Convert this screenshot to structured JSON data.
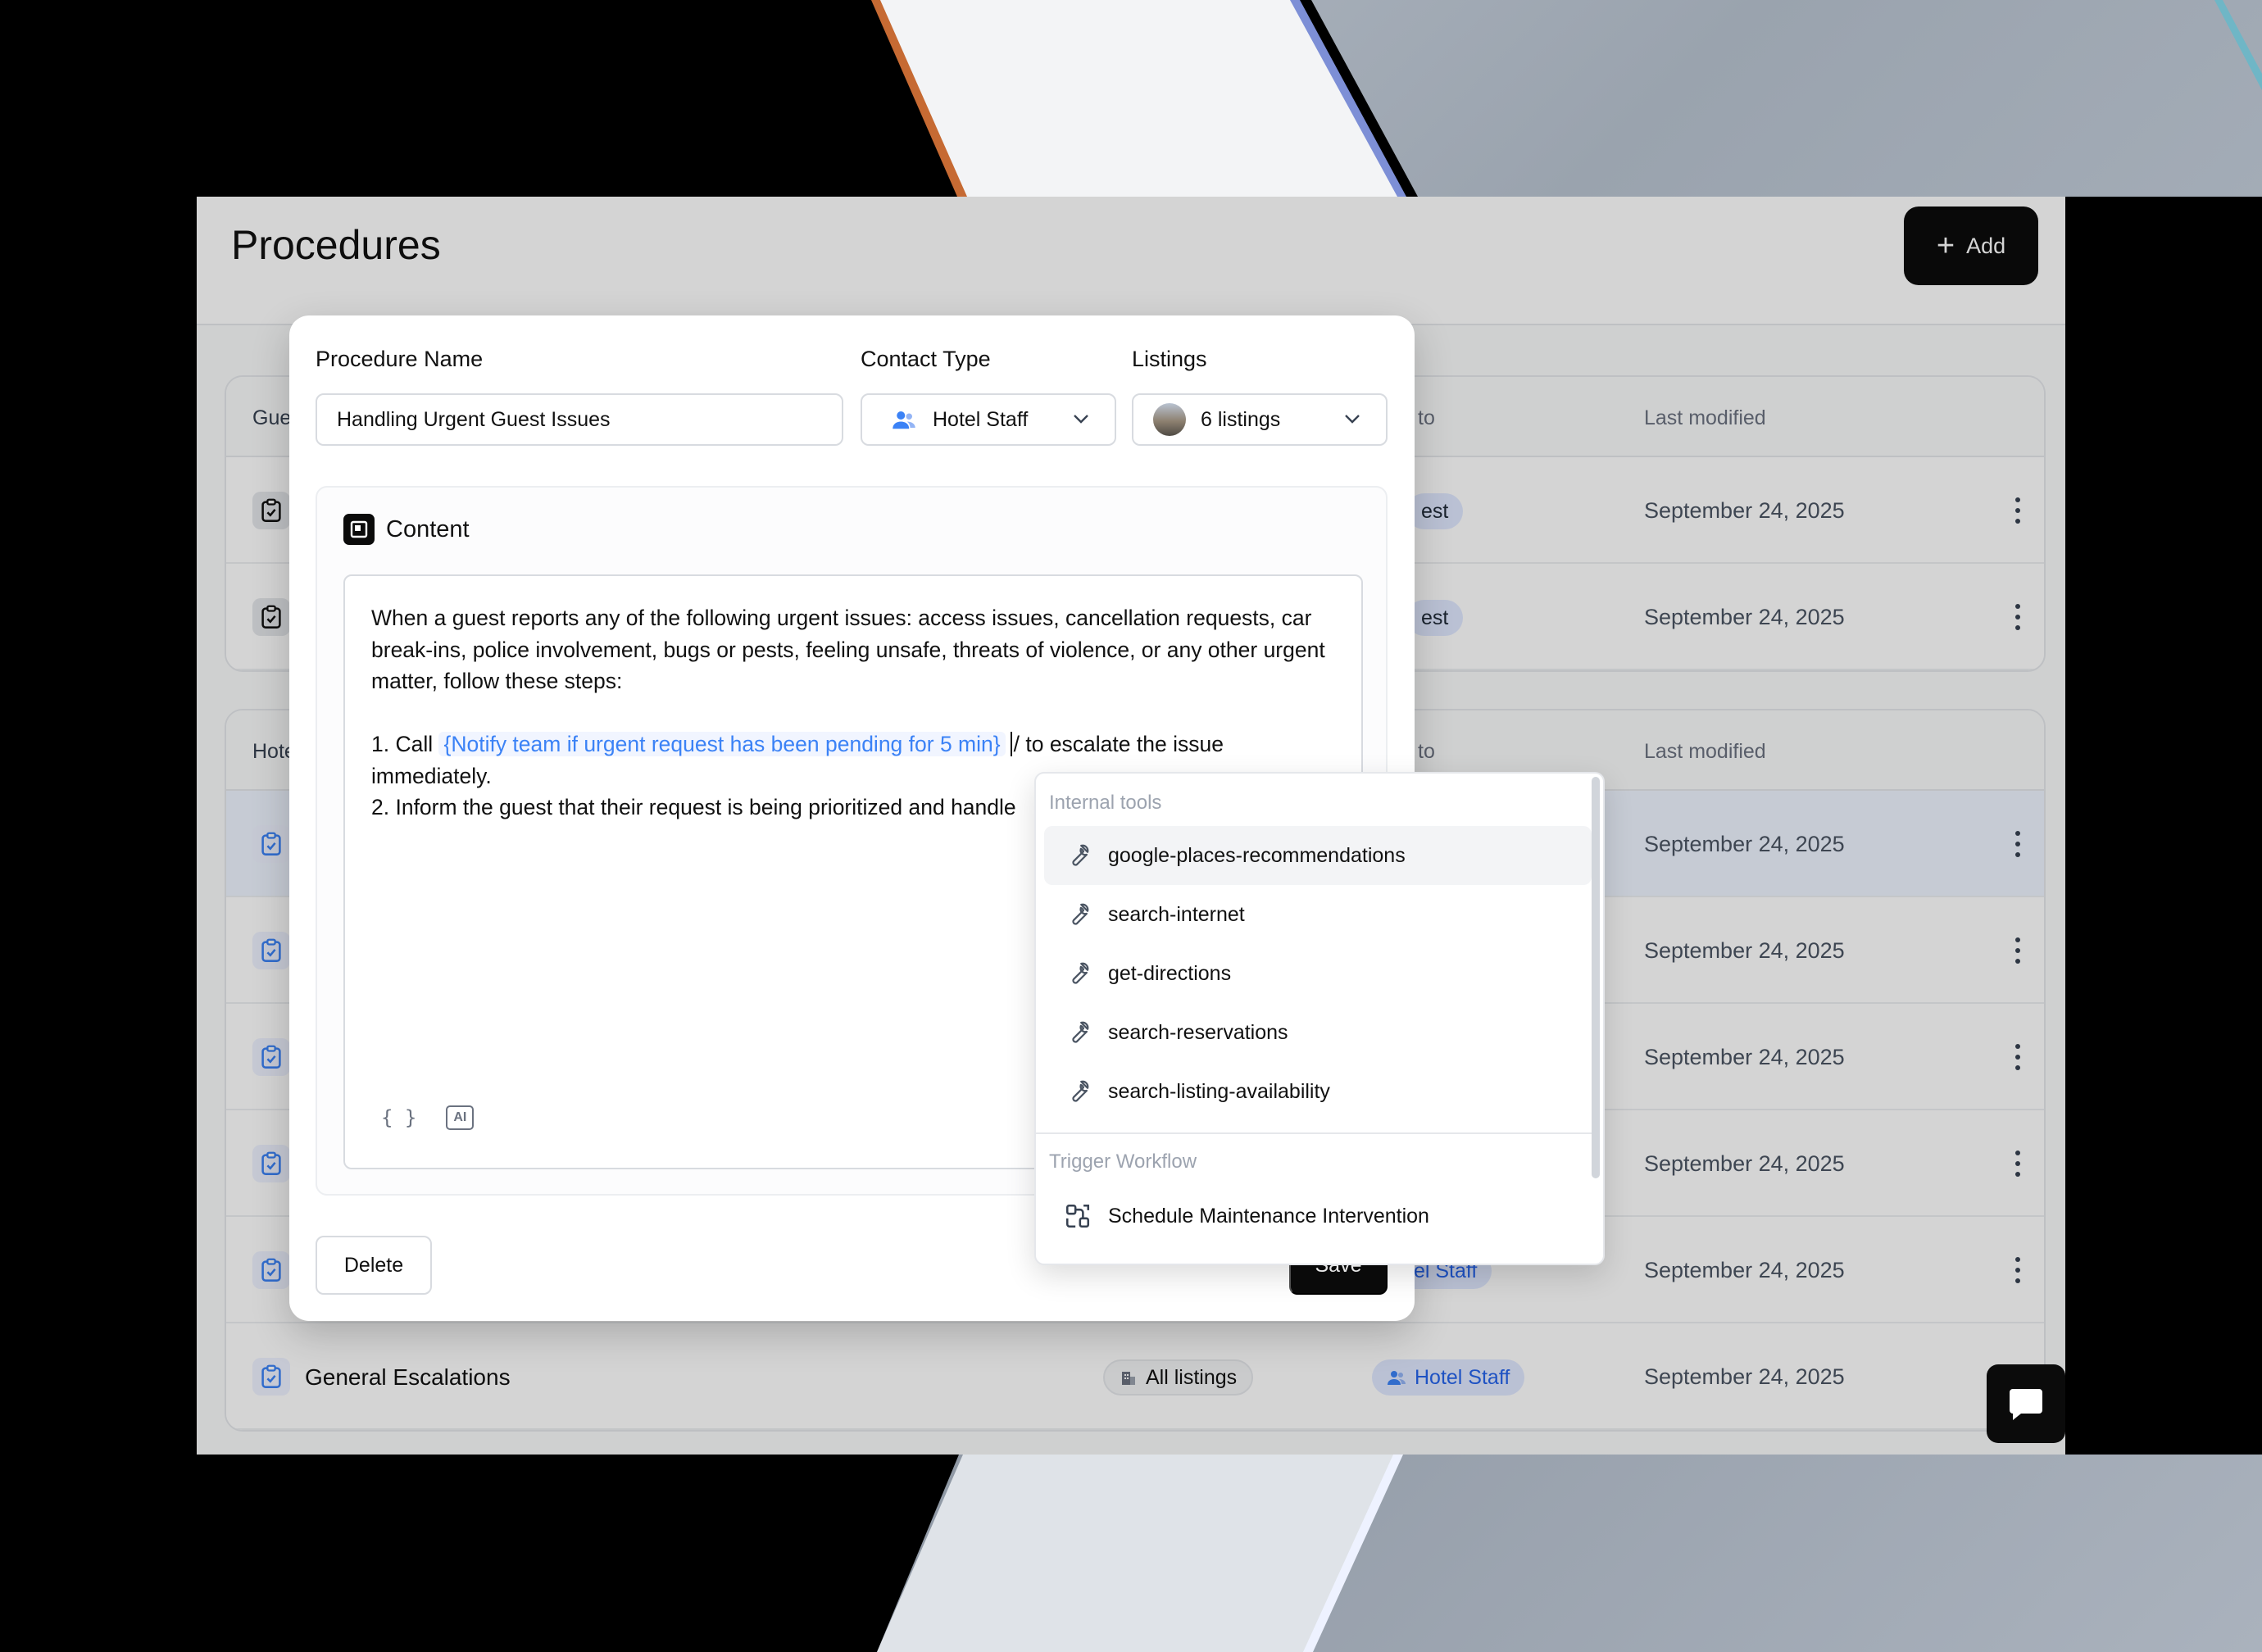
{
  "app": {
    "page_title": "Procedures",
    "add_label": "Add"
  },
  "background_table": {
    "groups": [
      {
        "title": "Gue",
        "assigned_header": "to",
        "modified_header": "Last modified",
        "rows": [
          {
            "pill_text": "est",
            "date": "September 24, 2025"
          },
          {
            "pill_text": "est",
            "date": "September 24, 2025"
          }
        ]
      },
      {
        "title": "Hote",
        "assigned_header": "to",
        "modified_header": "Last modified",
        "rows": [
          {
            "date": "September 24, 2025"
          },
          {
            "date": "September 24, 2025"
          },
          {
            "date": "September 24, 2025"
          },
          {
            "date": "September 24, 2025"
          },
          {
            "pill_text": "tel Staff",
            "date": "September 24, 2025"
          },
          {
            "name": "General Escalations",
            "listings": "All listings",
            "contact": "Hotel Staff",
            "date": "September 24, 2025"
          }
        ]
      }
    ]
  },
  "modal": {
    "name_label": "Procedure Name",
    "name_value": "Handling Urgent Guest Issues",
    "contact_label": "Contact Type",
    "contact_value": "Hotel Staff",
    "listings_label": "Listings",
    "listings_value": "6 listings",
    "content_title": "Content",
    "editor": {
      "intro": "When a guest reports any of the following urgent issues: access issues, cancellation requests, car break-ins, police involvement, bugs or pests, feeling unsafe, threats of violence, or any other urgent matter, follow these steps:",
      "step1_prefix": "1. Call ",
      "step1_variable": "{Notify team if urgent request has been pending for 5 min}",
      "step1_slash": "/",
      "step1_suffix": "to escalate the issue immediately.",
      "step2": "2. Inform the guest that their request is being prioritized and handle",
      "tool_braces": "{ }",
      "tool_ai": "AI"
    },
    "delete_label": "Delete",
    "save_label": "Save"
  },
  "dropdown": {
    "section1": "Internal tools",
    "tools": [
      "google-places-recommendations",
      "search-internet",
      "get-directions",
      "search-reservations",
      "search-listing-availability"
    ],
    "section2": "Trigger Workflow",
    "workflows": [
      "Schedule Maintenance Intervention"
    ]
  },
  "colors": {
    "accent_blue": "#3b82f6",
    "primary_black": "#0b0b0b"
  }
}
